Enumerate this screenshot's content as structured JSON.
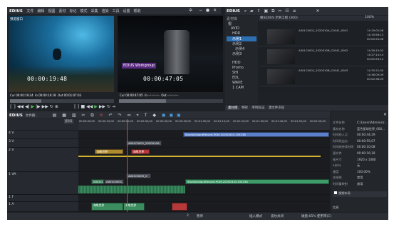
{
  "app": {
    "title": "EDIUS",
    "menu": [
      "文件",
      "编辑",
      "视图",
      "素材",
      "标记",
      "模式",
      "采集",
      "渲染",
      "工具",
      "设置",
      "帮助"
    ]
  },
  "player": {
    "left_label": "预览窗口",
    "left_timecode": "00:00:19:48",
    "right_timecode": "00:00:47:05",
    "right_overlay": "EDIUS Workgroup",
    "cue_left": "Cur 00:00:19:24",
    "in_left": "In 00:00:16:18",
    "out_left": "Out 00:01:07:03",
    "cue_right": "Cur 00:00:47:05",
    "in_right": "In --:--:--:--",
    "out_right": "Out --:--:--:--"
  },
  "bin": {
    "title": "EDIUS",
    "label": "素材库",
    "path": "根\\EDIUS 示例工程 (300)",
    "zoom": "100%",
    "tree": [
      {
        "label": "根"
      },
      {
        "label": "AVID"
      },
      {
        "label": "HDR"
      },
      {
        "label": "示例1"
      },
      {
        "label": "示例2"
      },
      {
        "label": "示例4"
      },
      {
        "label": "示例3"
      },
      {
        "label": "HDO"
      },
      {
        "label": "Promo"
      },
      {
        "label": "SHI"
      },
      {
        "label": "EDL"
      },
      {
        "label": "WAVE"
      },
      {
        "label": "1 CAM"
      }
    ],
    "items": [
      {
        "name": "A001C0001_2020010A_C0041_0001",
        "t1": "14:19:02:06",
        "t2": "14:19:56:12",
        "t3": "00:00:54:06"
      },
      {
        "name": "A001C0001_2020010B_C0041_0002",
        "t1": "14:26:15:02",
        "t2": "14:27:14:14",
        "t3": "00:00:59:12"
      },
      {
        "name": "A001C0001_2020010B_C0041_0003",
        "t1": "14:35:22:00",
        "t2": "14:36:00:09",
        "t3": "00:00:38:09"
      }
    ],
    "tabs": [
      "素材库",
      "特效",
      "序列标记",
      "源文件浏览"
    ]
  },
  "timeline": {
    "label": "EDIUS",
    "sequence": "文件路：",
    "timecode_tab": "序列1",
    "ruler": [
      "00:00:00;00",
      "00:00:10;00",
      "00:00:20;00",
      "00:00:30;00",
      "00:00:40;00",
      "00:00:50;00",
      "00:01:00;00",
      "00:01:10;00",
      "00:01:20;00",
      "00:01:30;00",
      "00:01:40;00",
      "00:01:50;00",
      "00:02:00;00"
    ],
    "tracks": [
      {
        "name": "4 V"
      },
      {
        "name": "3 V"
      },
      {
        "name": "2 V"
      },
      {
        "name": "1 VA"
      },
      {
        "name": "1 T"
      },
      {
        "name": "1 A"
      }
    ],
    "clip_labels": {
      "studio": "StudioOutputRecord-PGM-20200410-155238",
      "a1": "A001C0001_2020010A",
      "a2": "A001C0003_2",
      "sample": "海龟世界",
      "aud": "海龟世界"
    },
    "status": {
      "page": "2",
      "state": "暂停",
      "mode": "插入模式",
      "sync": "波纹关闭",
      "disk": "磁盘:65% 使用率(C)"
    }
  },
  "info": {
    "title": "信息",
    "rows": [
      {
        "k": "文件名称",
        "v": "C:\\Users\\Administr..."
      },
      {
        "k": "素材名称",
        "v": "蓝色星球世界_000..."
      },
      {
        "k": "时间线入点",
        "v": "00:00:44;29"
      },
      {
        "k": "时间线出点",
        "v": "00:00:55;07"
      },
      {
        "k": "时间线持续时间",
        "v": "00:00:10;08"
      },
      {
        "k": "源文件",
        "v": "00:00:16;18"
      },
      {
        "k": "帧尺寸",
        "v": "1920 x 1080"
      },
      {
        "k": "alpha",
        "v": "无"
      },
      {
        "k": "速度",
        "v": "100.00%"
      },
      {
        "k": "冻结帧",
        "v": "禁用"
      },
      {
        "k": "时间重映射",
        "v": "禁用"
      }
    ],
    "effect": "视频布局"
  }
}
